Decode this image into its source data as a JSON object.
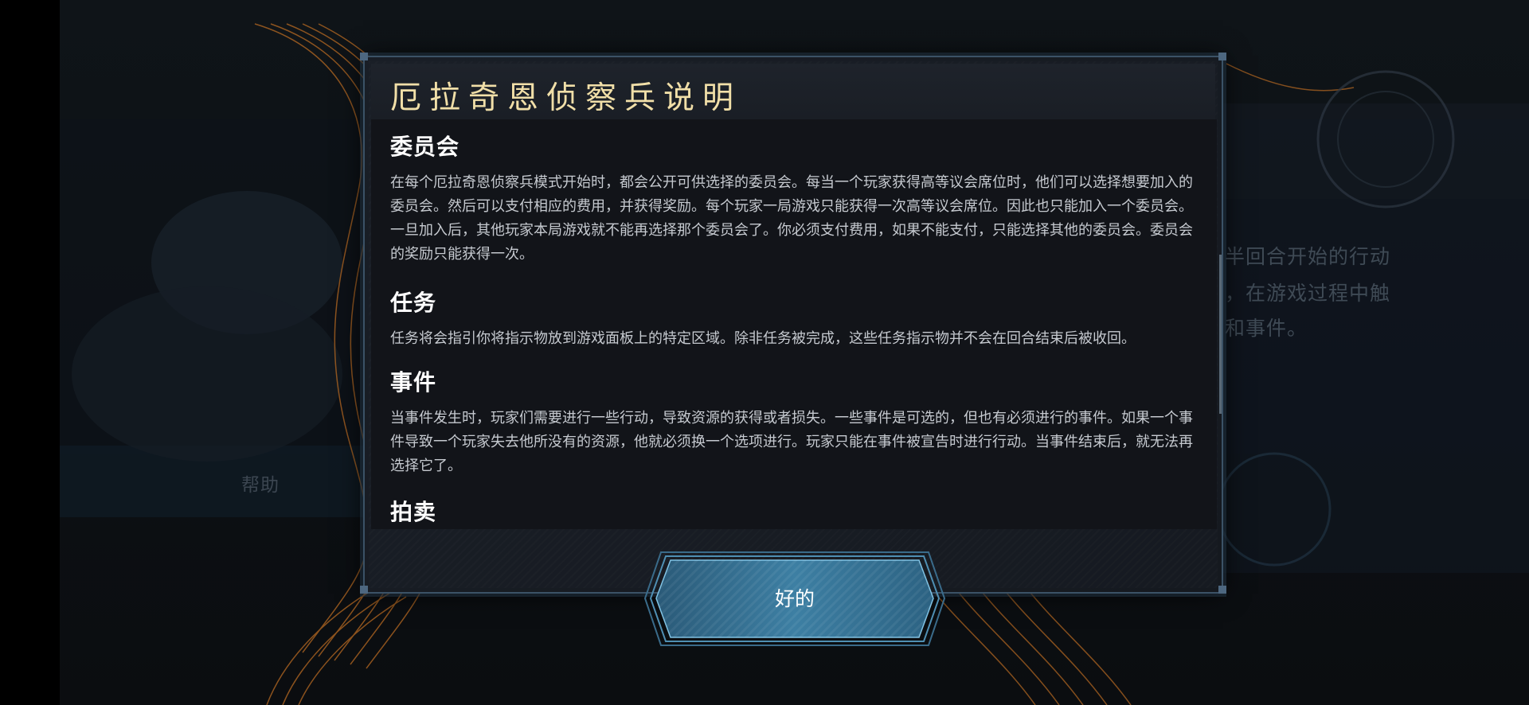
{
  "background": {
    "help_label": "帮助",
    "right_text_lines": [
      "半回合开始的行动",
      "，在游戏过程中触",
      "和事件。"
    ]
  },
  "dialog": {
    "title": "厄拉奇恩侦察兵说明",
    "sections": [
      {
        "heading": "委员会",
        "body": "在每个厄拉奇恩侦察兵模式开始时，都会公开可供选择的委员会。每当一个玩家获得高等议会席位时，他们可以选择想要加入的委员会。然后可以支付相应的费用，并获得奖励。每个玩家一局游戏只能获得一次高等议会席位。因此也只能加入一个委员会。一旦加入后，其他玩家本局游戏就不能再选择那个委员会了。你必须支付费用，如果不能支付，只能选择其他的委员会。委员会的奖励只能获得一次。"
      },
      {
        "heading": "任务",
        "body": "任务将会指引你将指示物放到游戏面板上的特定区域。除非任务被完成，这些任务指示物并不会在回合结束后被收回。"
      },
      {
        "heading": "事件",
        "body": "当事件发生时，玩家们需要进行一些行动，导致资源的获得或者损失。一些事件是可选的，但也有必须进行的事件。如果一个事件导致一个玩家失去他所没有的资源，他就必须换一个选项进行。玩家只能在事件被宣告时进行行动。当事件结束后，就无法再选择它了。"
      },
      {
        "heading": "拍卖",
        "body": ""
      }
    ],
    "ok_label": "好的"
  },
  "colors": {
    "title_gold": "#f1dfa8",
    "frame_steel": "#3b5266",
    "button_blue": "#3d7fa3",
    "accent_orange": "#c9782a"
  }
}
